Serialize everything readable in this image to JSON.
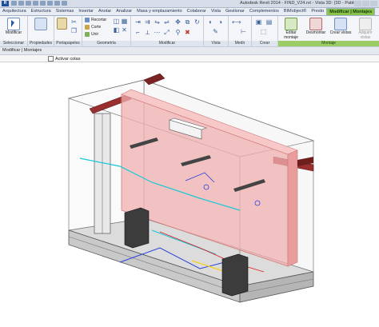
{
  "window": {
    "title": "Autodesk Revit 2014 -    FIND_V24.rvt - Vista 3D: {3D - Pablo}",
    "app_badge": "R"
  },
  "tabs": [
    {
      "label": "Arquitectura"
    },
    {
      "label": "Estructura"
    },
    {
      "label": "Sistemas"
    },
    {
      "label": "Insertar"
    },
    {
      "label": "Anotar"
    },
    {
      "label": "Analizar"
    },
    {
      "label": "Masa y emplazamiento"
    },
    {
      "label": "Colaborar"
    },
    {
      "label": "Vista"
    },
    {
      "label": "Gestionar"
    },
    {
      "label": "Complementos"
    },
    {
      "label": "BIMobject®"
    },
    {
      "label": "Presto"
    },
    {
      "label": "Modificar | Montajes"
    }
  ],
  "ribbon": {
    "modify_label": "Modificar",
    "cut_label": "Recortar",
    "cut2_label": "Corte",
    "join_label": "Unir",
    "edit_assembly_label": "Editar montaje",
    "disassemble_label": "Desmontar",
    "create_views_label": "Crear vistas",
    "acquire_views_label": "Adquirir vistas",
    "panels": {
      "select": "Seleccionar",
      "properties": "Propiedades",
      "clipboard": "Portapapeles",
      "geometry": "Geometría",
      "modify": "Modificar",
      "view": "Vista",
      "measure": "Medir",
      "create": "Crear",
      "assembly": "Montaje"
    }
  },
  "context_bar": {
    "label": "Modificar | Montajes"
  },
  "options_bar": {
    "activate_dimensions": "Activar cotas"
  },
  "colors": {
    "accent_green": "#8bc34a",
    "wall_pink": "#f0b0b0",
    "beam_red": "#9a2f2f",
    "mep_cyan": "#19c8d6",
    "mep_yellow": "#f2d21b",
    "mep_blue": "#2a3fdb",
    "mep_red": "#e22020"
  },
  "icons": [
    "modify-icon",
    "properties-icon",
    "paste-icon",
    "cut-icon",
    "join-icon",
    "move-icon",
    "rotate-icon",
    "mirror-icon",
    "trim-icon",
    "view-icon",
    "measure-icon",
    "create-icon",
    "edit-assembly-icon",
    "disassemble-icon",
    "create-views-icon",
    "acquire-views-icon"
  ]
}
